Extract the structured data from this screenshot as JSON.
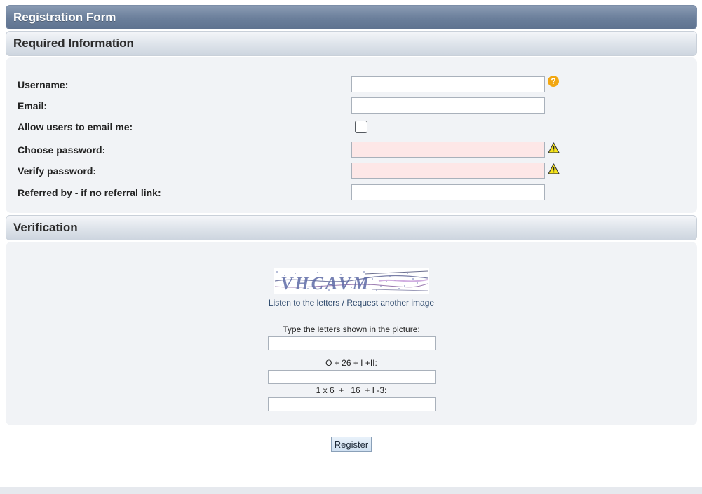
{
  "header": {
    "title": "Registration Form"
  },
  "required": {
    "section_title": "Required Information",
    "fields": {
      "username": {
        "label": "Username:",
        "value": "",
        "help_icon": "question-circle-icon"
      },
      "email": {
        "label": "Email:",
        "value": ""
      },
      "allow_email": {
        "label": "Allow users to email me:",
        "checked": false
      },
      "choose_password": {
        "label": "Choose password:",
        "value": "",
        "warning_icon": "warning-triangle-icon"
      },
      "verify_password": {
        "label": "Verify password:",
        "value": "",
        "warning_icon": "warning-triangle-icon"
      },
      "referred_by": {
        "label": "Referred by - if no referral link:",
        "value": ""
      }
    }
  },
  "verification": {
    "section_title": "Verification",
    "captcha_text": "VHCAVM",
    "listen_link": "Listen to the letters",
    "separator": "/",
    "request_link": "Request another image",
    "type_letters_label": "Type the letters shown in the picture:",
    "question1": "O + 26 + I +II:",
    "question2": "1 x 6  +   16  + I -3:"
  },
  "actions": {
    "register_label": "Register"
  },
  "colors": {
    "title_bar": "#6b7f9b",
    "section_bar": "#dde3ea",
    "panel_bg": "#f1f3f6",
    "password_field_bg": "#fde7e7",
    "help_icon": "#f2a712",
    "link": "#2f4a6d"
  }
}
